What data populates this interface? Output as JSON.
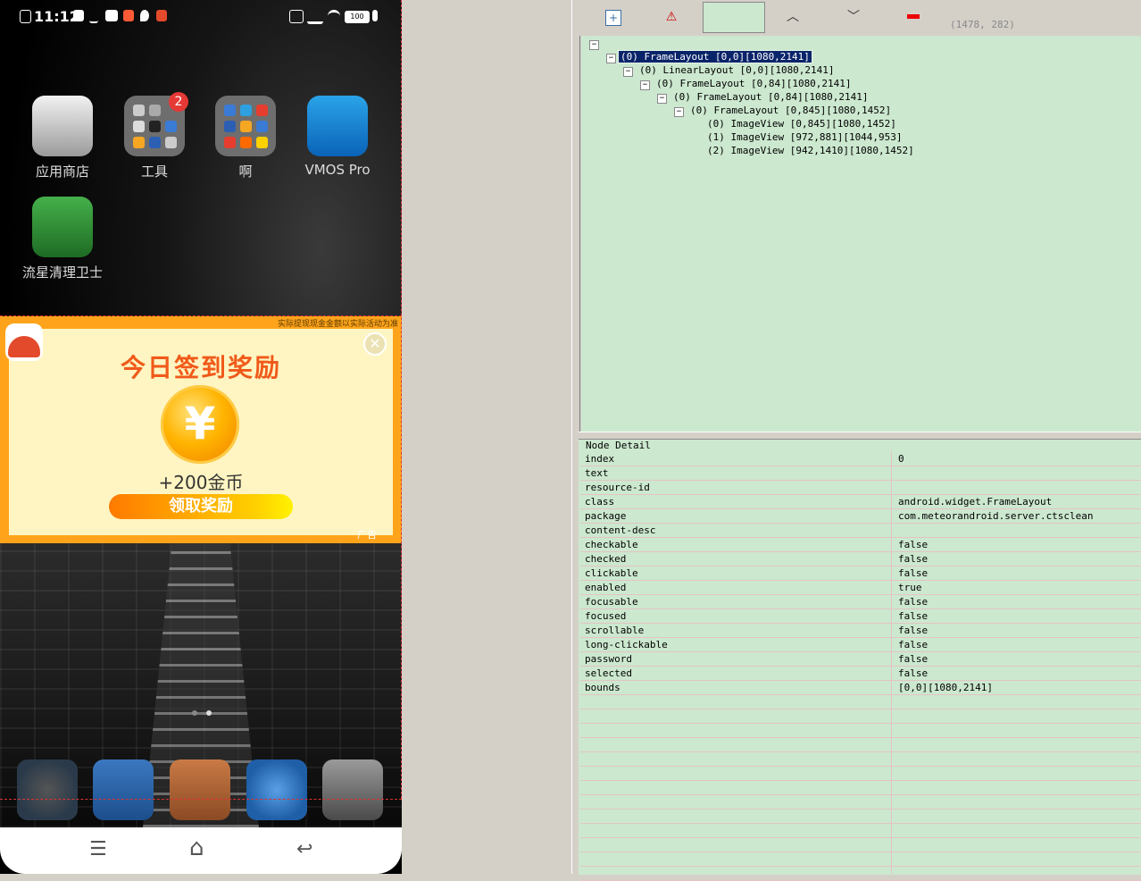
{
  "phone": {
    "status": {
      "time": "11:12",
      "battery": "100"
    },
    "apps": [
      {
        "label": "应用商店",
        "icon": "shopping-bag-icon"
      },
      {
        "label": "工具",
        "icon": "folder-icon",
        "badge": "2"
      },
      {
        "label": "啊",
        "icon": "folder-icon"
      },
      {
        "label": "VMOS Pro",
        "icon": "vmos-icon"
      },
      {
        "label": "流星清理卫士",
        "icon": "rocket-icon"
      }
    ],
    "ad": {
      "disclaimer": "实际提现现金金额以实际活动为准",
      "title": "今日签到奖励",
      "coin_symbol": "¥",
      "amount": "+200金币",
      "button": "领取奖励",
      "close": "✕",
      "mark": "广告"
    },
    "dock": [
      "settings-icon",
      "security-icon",
      "files-icon",
      "browser-icon",
      "camera-icon"
    ],
    "nav": {
      "menu": "☰",
      "home": "⌂",
      "back": "↩"
    },
    "colors": {
      "ad_orange": "#ffa41a",
      "ad_bg": "#fff5c2",
      "title": "#f05a1a"
    }
  },
  "inspector": {
    "toolbar": {
      "coord": "(1478, 282)",
      "expand": "+",
      "warn": "⚠",
      "up": "︿",
      "down": "﹀"
    },
    "tree": [
      {
        "text": "(0) FrameLayout [0,0][1080,2141]",
        "selected": true
      },
      {
        "text": "(0) LinearLayout [0,0][1080,2141]"
      },
      {
        "text": "(0) FrameLayout [0,84][1080,2141]"
      },
      {
        "text": "(0) FrameLayout [0,84][1080,2141]"
      },
      {
        "text": "(0) FrameLayout [0,845][1080,1452]"
      },
      {
        "text": "(0) ImageView [0,845][1080,1452]"
      },
      {
        "text": "(1) ImageView [972,881][1044,953]"
      },
      {
        "text": "(2) ImageView [942,1410][1080,1452]"
      }
    ],
    "detail_title": "Node Detail",
    "details": [
      {
        "k": "index",
        "v": "0"
      },
      {
        "k": "text",
        "v": ""
      },
      {
        "k": "resource-id",
        "v": ""
      },
      {
        "k": "class",
        "v": "android.widget.FrameLayout"
      },
      {
        "k": "package",
        "v": "com.meteorandroid.server.ctsclean"
      },
      {
        "k": "content-desc",
        "v": ""
      },
      {
        "k": "checkable",
        "v": "false"
      },
      {
        "k": "checked",
        "v": "false"
      },
      {
        "k": "clickable",
        "v": "false"
      },
      {
        "k": "enabled",
        "v": "true"
      },
      {
        "k": "focusable",
        "v": "false"
      },
      {
        "k": "focused",
        "v": "false"
      },
      {
        "k": "scrollable",
        "v": "false"
      },
      {
        "k": "long-clickable",
        "v": "false"
      },
      {
        "k": "password",
        "v": "false"
      },
      {
        "k": "selected",
        "v": "false"
      },
      {
        "k": "bounds",
        "v": "[0,0][1080,2141]"
      }
    ]
  }
}
